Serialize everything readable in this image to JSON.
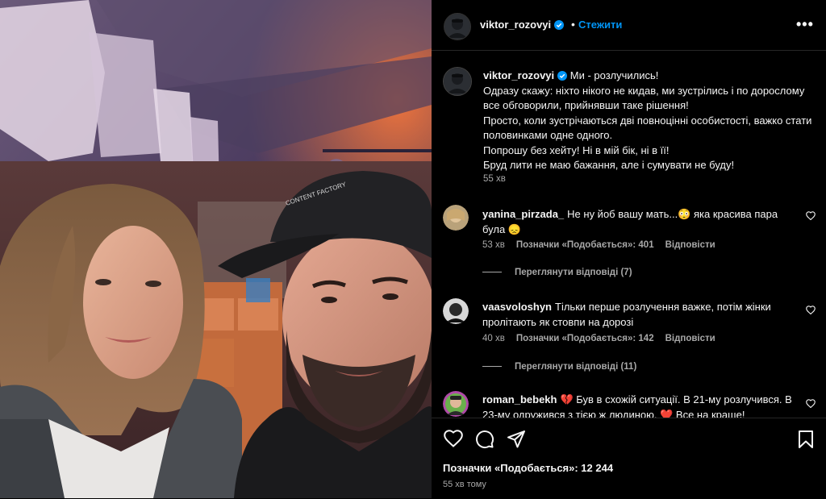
{
  "post": {
    "username": "viktor_rozovyi",
    "dot": "•",
    "follow_label": "Стежити",
    "more_label": "•••",
    "photo_cap_text": "CONTENT FACTORY",
    "caption_lines": [
      "Ми - розлучились!",
      "Одразу скажу: ніхто нікого не кидав, ми зустрілись і по дорослому все обговорили, прийнявши таке рішення!",
      "Просто, коли зустрічаються дві повноцінні особистості, важко стати половинками одне одного.",
      "Попрошу без хейту! Ні в мій бік, ні в її!",
      "Бруд лити не маю бажання, але і сумувати не буду!"
    ],
    "caption_time": "55 хв"
  },
  "comments": [
    {
      "username": "yanina_pirzada_",
      "text": "Не ну йоб вашу мать...😳 яка красива пара була 😞",
      "time": "53 хв",
      "likes": "Позначки «Подобається»: 401",
      "reply": "Відповісти",
      "view_replies": "Переглянути відповіді (7)"
    },
    {
      "username": "vaasvoloshyn",
      "text": "Тільки перше розлучення важке, потім жінки пролітають як стовпи на дорозі",
      "time": "40 хв",
      "likes": "Позначки «Подобається»: 142",
      "reply": "Відповісти",
      "view_replies": "Переглянути відповіді (11)"
    },
    {
      "username": "roman_bebekh",
      "text": "💔 Був в схожій ситуації. В 21-му розлучився. В 23-му одружився з тією ж людиною. ❤️ Все на краще!"
    }
  ],
  "footer": {
    "likes": "Позначки «Подобається»: 12 244",
    "posted": "55 хв тому"
  },
  "icons": [
    "heart-icon",
    "comment-icon",
    "share-icon",
    "bookmark-icon",
    "verified-icon",
    "more-icon"
  ],
  "colors": {
    "accent": "#0095f6",
    "background": "#000000",
    "secondary_text": "#a8a8a8"
  }
}
